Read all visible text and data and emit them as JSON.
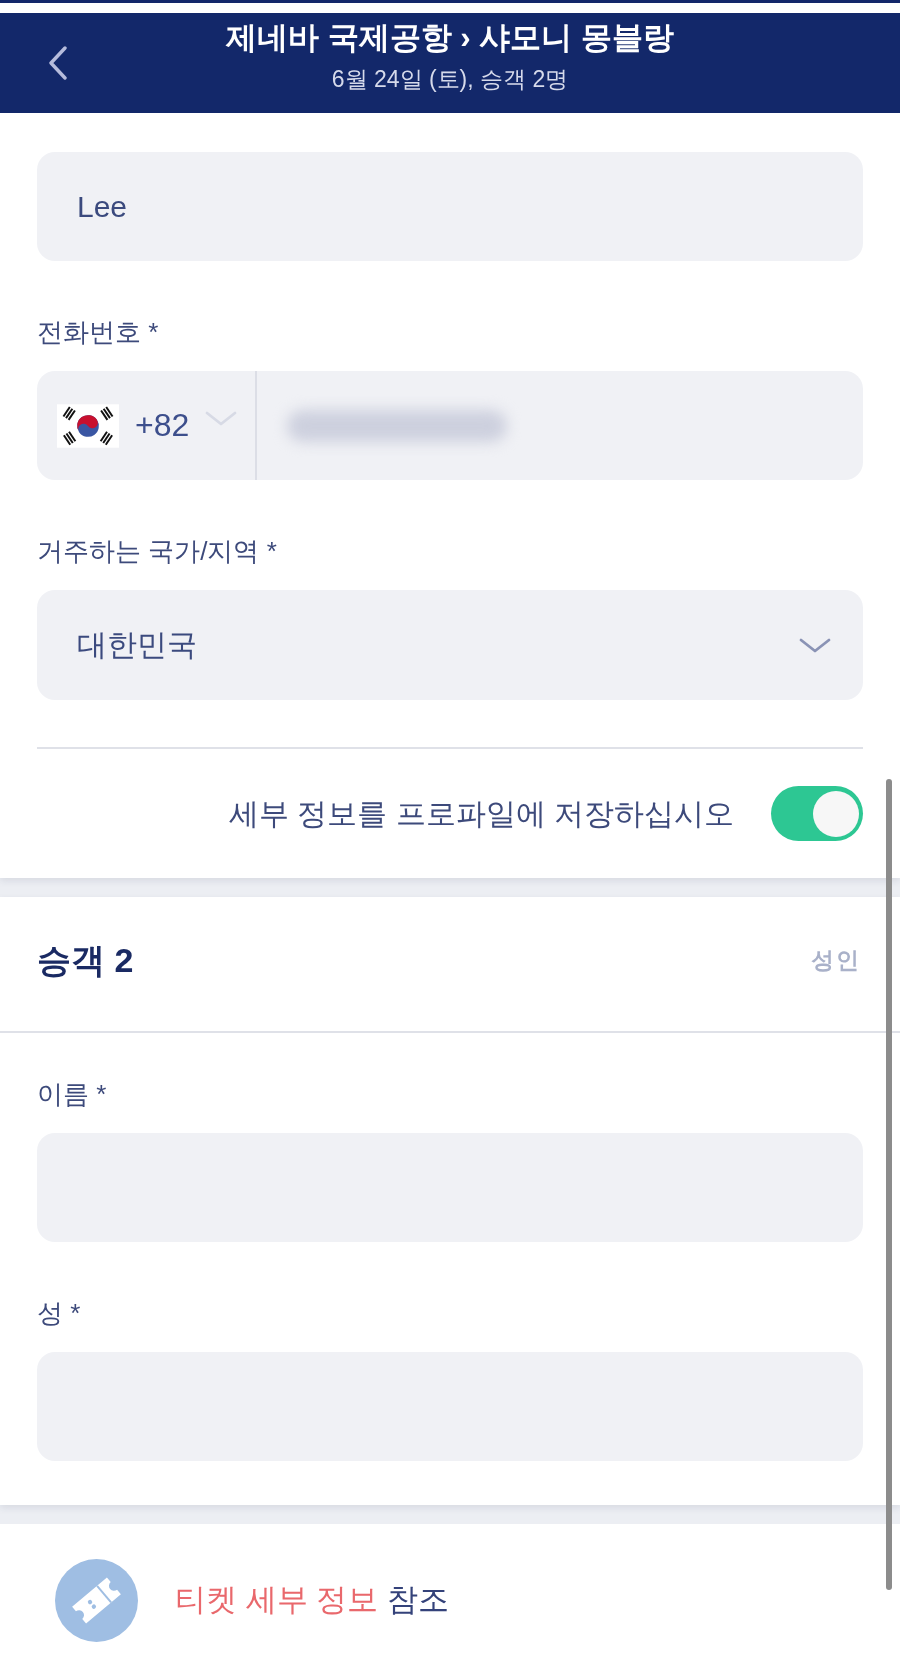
{
  "header": {
    "title": "제네바 국제공항 › 샤모니 몽블랑",
    "subtitle": "6월 24일 (토), 승객 2명"
  },
  "passenger_1": {
    "fields": [
      {
        "kind": "text",
        "value": "Lee"
      },
      {
        "kind": "phone",
        "label": "전화번호 *",
        "country_code": "+82",
        "value_redacted": true
      },
      {
        "kind": "select",
        "label": "거주하는 국가/지역 *",
        "value": "대한민국"
      }
    ],
    "save_toggle": {
      "label": "세부 정보를 프로파일에 저장하십시오",
      "on": true
    }
  },
  "passenger_2": {
    "title": "승객 2",
    "type": "성인",
    "fields": [
      {
        "kind": "text",
        "label": "이름 *"
      },
      {
        "kind": "text",
        "label": "성 *"
      }
    ]
  },
  "ticket_details": {
    "link": "티켓 세부 정보",
    "text": "참조"
  }
}
